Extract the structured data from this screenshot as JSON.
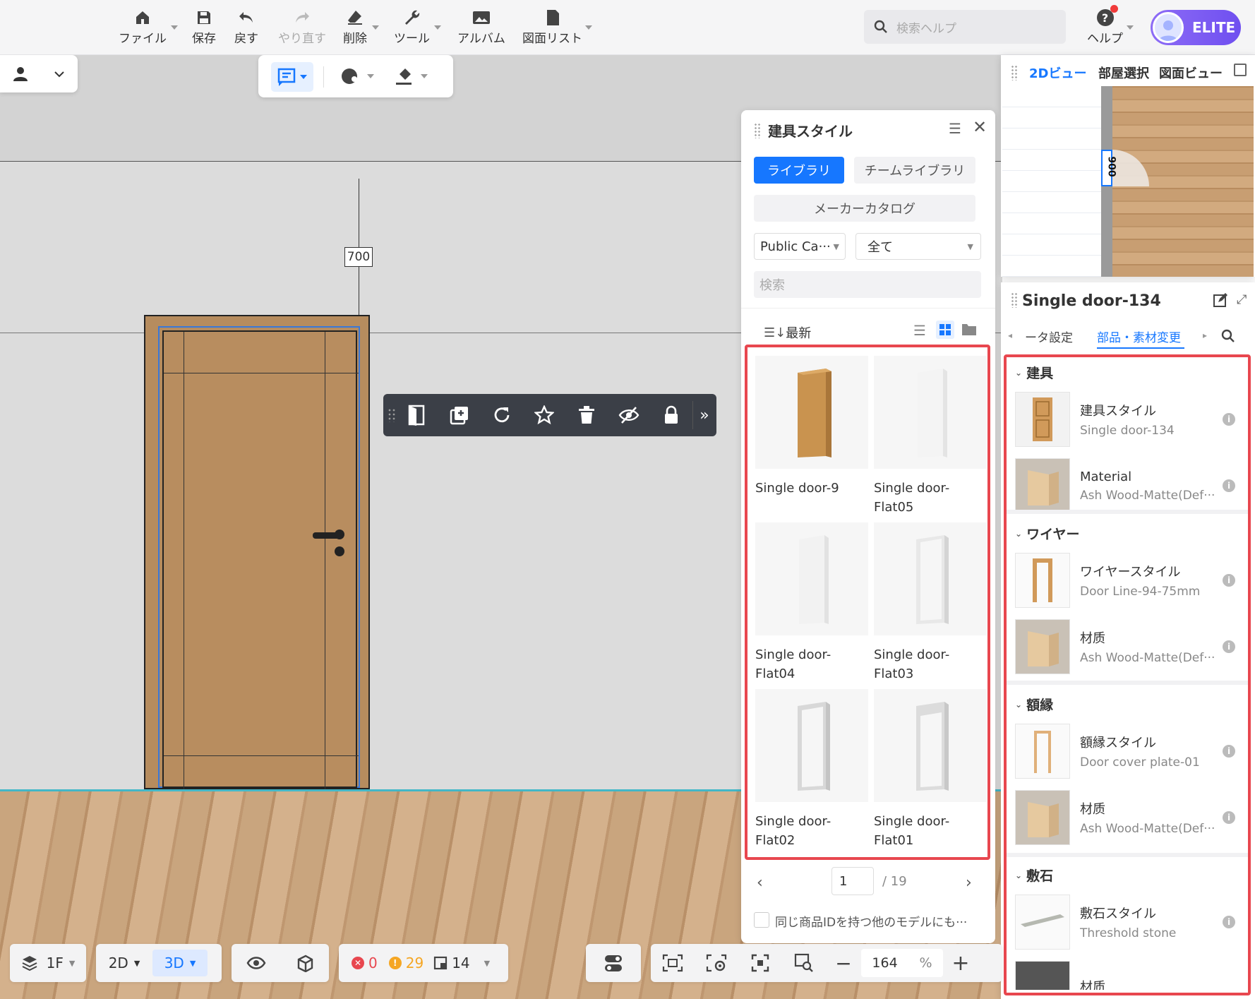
{
  "toolbar": {
    "file": "ファイル",
    "save": "保存",
    "undo": "戻す",
    "redo": "やり直す",
    "delete": "削除",
    "tools": "ツール",
    "album": "アルバム",
    "drawing_list": "図面リスト",
    "search_placeholder": "検索ヘルプ",
    "help": "ヘルプ",
    "badge": "ELITE"
  },
  "scene": {
    "dimension": "700"
  },
  "style_panel": {
    "title": "建具スタイル",
    "tab_library": "ライブラリ",
    "tab_team": "チームライブラリ",
    "tab_maker": "メーカーカタログ",
    "select_catalog": "Public Ca···",
    "select_all": "全て",
    "search_placeholder": "検索",
    "sort": "最新",
    "items": [
      {
        "name1": "Single door-9",
        "name2": ""
      },
      {
        "name1": "Single door-",
        "name2": "Flat05"
      },
      {
        "name1": "Single door-",
        "name2": "Flat04"
      },
      {
        "name1": "Single door-",
        "name2": "Flat03"
      },
      {
        "name1": "Single door-",
        "name2": "Flat02"
      },
      {
        "name1": "Single door-",
        "name2": "Flat01"
      }
    ],
    "page": "1",
    "total_pages": "/ 19",
    "checkbox_label": "同じ商品IDを持つ他のモデルにも···"
  },
  "view2d": {
    "tab1": "2Dビュー",
    "tab2": "部屋選択",
    "tab3": "図面ビュー",
    "dim": "900"
  },
  "props": {
    "title": "Single door-134",
    "tab_data": "ータ設定",
    "tab_parts": "部品・素材変更",
    "sections": [
      {
        "title": "建具",
        "rows": [
          {
            "t1": "建具スタイル",
            "t2": "Single door-134"
          },
          {
            "t1": "Material",
            "t2": "Ash Wood-Matte(Def···"
          }
        ]
      },
      {
        "title": "ワイヤー",
        "rows": [
          {
            "t1": "ワイヤースタイル",
            "t2": "Door Line-94-75mm"
          },
          {
            "t1": "材质",
            "t2": "Ash Wood-Matte(Def···"
          }
        ]
      },
      {
        "title": "額縁",
        "rows": [
          {
            "t1": "額縁スタイル",
            "t2": "Door cover plate-01"
          },
          {
            "t1": "材质",
            "t2": "Ash Wood-Matte(Def···"
          }
        ]
      },
      {
        "title": "敷石",
        "rows": [
          {
            "t1": "敷石スタイル",
            "t2": "Threshold stone"
          },
          {
            "t1": "材质",
            "t2": ""
          }
        ]
      }
    ]
  },
  "bottom": {
    "floor": "1F",
    "mode2d": "2D",
    "mode3d": "3D",
    "errors": "0",
    "warnings": "29",
    "count": "14",
    "zoom": "164",
    "zoom_unit": "%"
  },
  "colors": {
    "accent": "#1677ff",
    "highlight": "#e8474f"
  }
}
